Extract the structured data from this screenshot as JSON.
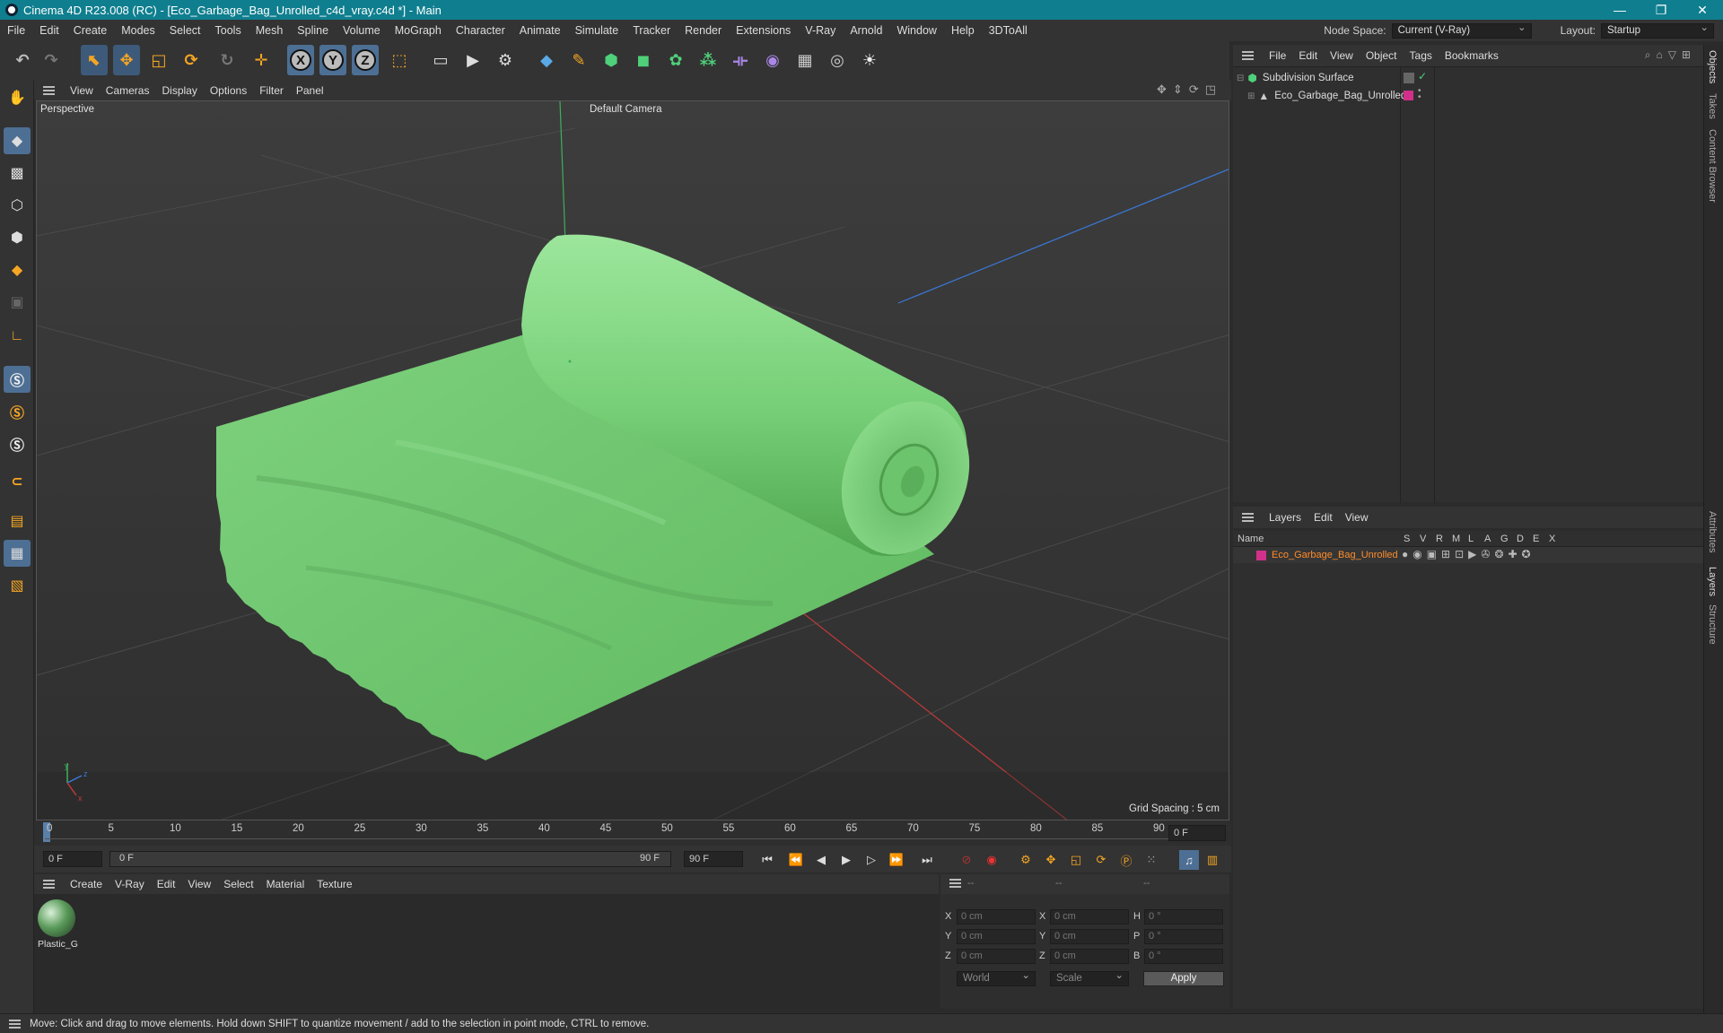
{
  "window": {
    "title": "Cinema 4D R23.008 (RC) - [Eco_Garbage_Bag_Unrolled_c4d_vray.c4d *] - Main",
    "minimize": "—",
    "restore": "❐",
    "close": "✕"
  },
  "menu": [
    "File",
    "Edit",
    "Create",
    "Modes",
    "Select",
    "Tools",
    "Mesh",
    "Spline",
    "Volume",
    "MoGraph",
    "Character",
    "Animate",
    "Simulate",
    "Tracker",
    "Render",
    "Extensions",
    "V-Ray",
    "Arnold",
    "Window",
    "Help",
    "3DToAll"
  ],
  "node_space": {
    "label": "Node Space:",
    "value": "Current (V-Ray)"
  },
  "layout": {
    "label": "Layout:",
    "value": "Startup"
  },
  "toolbar": {
    "axis_x": "X",
    "axis_y": "Y",
    "axis_z": "Z"
  },
  "viewport": {
    "menu": [
      "View",
      "Cameras",
      "Display",
      "Options",
      "Filter",
      "Panel"
    ],
    "projection": "Perspective",
    "camera": "Default Camera",
    "grid_spacing": "Grid Spacing : 5 cm",
    "axis_y": "y",
    "axis_z": "z",
    "axis_x": "x"
  },
  "timeline": {
    "ticks": [
      "0",
      "5",
      "10",
      "15",
      "20",
      "25",
      "30",
      "35",
      "40",
      "45",
      "50",
      "55",
      "60",
      "65",
      "70",
      "75",
      "80",
      "85",
      "90"
    ],
    "current_frame": "0 F",
    "start": "0 F",
    "range_start": "0 F",
    "range_end": "90 F",
    "end": "90 F"
  },
  "material_manager": {
    "menu": [
      "Create",
      "V-Ray",
      "Edit",
      "View",
      "Select",
      "Material",
      "Texture"
    ],
    "materials": [
      {
        "name": "Plastic_G"
      }
    ]
  },
  "coordinates": {
    "header": [
      "--",
      "--",
      "--"
    ],
    "rows": [
      {
        "l1": "X",
        "v1": "0 cm",
        "l2": "X",
        "v2": "0 cm",
        "l3": "H",
        "v3": "0 °"
      },
      {
        "l1": "Y",
        "v1": "0 cm",
        "l2": "Y",
        "v2": "0 cm",
        "l3": "P",
        "v3": "0 °"
      },
      {
        "l1": "Z",
        "v1": "0 cm",
        "l2": "Z",
        "v2": "0 cm",
        "l3": "B",
        "v3": "0 °"
      }
    ],
    "space": "World",
    "mode": "Scale",
    "apply": "Apply"
  },
  "object_manager": {
    "menu": [
      "File",
      "Edit",
      "View",
      "Object",
      "Tags",
      "Bookmarks"
    ],
    "objects": [
      {
        "name": "Subdivision Surface"
      },
      {
        "name": "Eco_Garbage_Bag_Unrolled"
      }
    ]
  },
  "layer_manager": {
    "menu": [
      "Layers",
      "Edit",
      "View"
    ],
    "columns": [
      "Name",
      "S",
      "V",
      "R",
      "M",
      "L",
      "A",
      "G",
      "D",
      "E",
      "X"
    ],
    "layers": [
      {
        "name": "Eco_Garbage_Bag_Unrolled",
        "color": "#d0308a"
      }
    ]
  },
  "side_tabs": [
    "Objects",
    "Takes",
    "Content Browser",
    "Attributes",
    "Layers",
    "Structure"
  ],
  "status": "Move: Click and drag to move elements. Hold down SHIFT to quantize movement / add to the selection in point mode, CTRL to remove.",
  "colors": {
    "accent": "#0f7f8f",
    "bag_green": "#7ed67e",
    "selected_blue": "#4d6f94",
    "layer_text": "#ff8c2a"
  }
}
